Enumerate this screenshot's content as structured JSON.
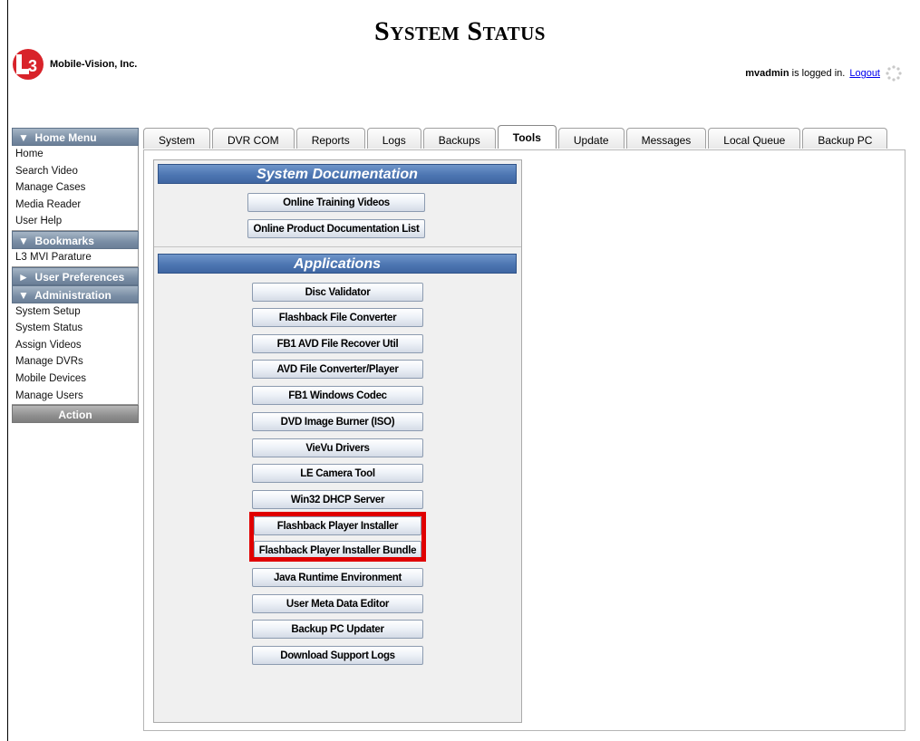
{
  "header": {
    "title": "System Status",
    "company": "Mobile-Vision, Inc.",
    "username": "mvadmin",
    "logged_in_text": " is logged in.",
    "logout_label": "Logout"
  },
  "sidebar": {
    "home_menu": {
      "title": "▼  Home Menu",
      "items": [
        "Home",
        "Search Video",
        "Manage Cases",
        "Media Reader",
        "User Help"
      ]
    },
    "bookmarks": {
      "title": "▼  Bookmarks",
      "items": [
        "L3 MVI Parature"
      ]
    },
    "user_preferences": {
      "title": "►  User Preferences"
    },
    "administration": {
      "title": "▼  Administration",
      "items": [
        "System Setup",
        "System Status",
        "Assign Videos",
        "Manage DVRs",
        "Mobile Devices",
        "Manage Users"
      ]
    },
    "action_label": "Action"
  },
  "tabs": [
    "System",
    "DVR COM",
    "Reports",
    "Logs",
    "Backups",
    "Tools",
    "Update",
    "Messages",
    "Local Queue",
    "Backup PC"
  ],
  "active_tab": "Tools",
  "tools": {
    "documentation_title": "System Documentation",
    "documentation_buttons": [
      "Online Training Videos",
      "Online Product Documentation List"
    ],
    "applications_title": "Applications",
    "application_buttons": [
      "Disc Validator",
      "Flashback File Converter",
      "FB1 AVD File Recover Util",
      "AVD File Converter/Player",
      "FB1 Windows Codec",
      "DVD Image Burner (ISO)",
      "VieVu Drivers",
      "LE Camera Tool",
      "Win32 DHCP Server",
      "Flashback Player Installer",
      "Flashback Player Installer Bundle",
      "Java Runtime Environment",
      "User Meta Data Editor",
      "Backup PC Updater",
      "Download Support Logs"
    ],
    "highlighted_buttons": [
      "Flashback Player Installer",
      "Flashback Player Installer Bundle"
    ]
  },
  "colors": {
    "section_header": "#4d76b2",
    "sidebar_header": "#7a8ea5",
    "highlight": "#e00000",
    "link": "#0000ee"
  }
}
